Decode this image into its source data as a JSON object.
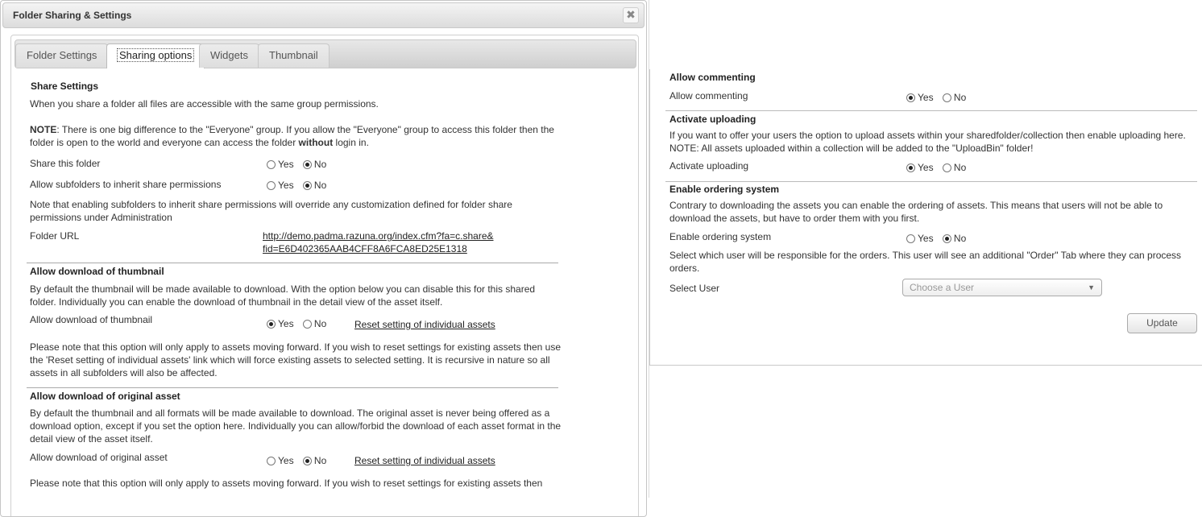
{
  "dialog": {
    "title": "Folder Sharing & Settings",
    "close_glyph": "✖"
  },
  "tabs": [
    {
      "label": "Folder Settings",
      "active": false
    },
    {
      "label": "Sharing options",
      "active": true
    },
    {
      "label": "Widgets",
      "active": false
    },
    {
      "label": "Thumbnail",
      "active": false
    }
  ],
  "share": {
    "heading": "Share Settings",
    "intro": "When you share a folder all files are accessible with the same group permissions.",
    "note_label": "NOTE",
    "note_text_1": ": There is one big difference to the \"Everyone\" group. If you allow the \"Everyone\" group to access this folder then the folder is open to the world and everyone can access the folder ",
    "note_bold": "without",
    "note_text_2": " login in.",
    "share_folder_label": "Share this folder",
    "share_folder_value": "No",
    "inherit_label": "Allow subfolders to inherit share permissions",
    "inherit_value": "No",
    "inherit_note": "Note that enabling subfolders to inherit share permissions will override any customization defined for folder share permissions under Administration",
    "folder_url_label": "Folder URL",
    "folder_url_line1": "http://demo.padma.razuna.org/index.cfm?fa=c.share&",
    "folder_url_line2": "fid=E6D402365AAB4CFF8A6FCA8ED25E1318"
  },
  "radio_labels": {
    "yes": "Yes",
    "no": "No"
  },
  "thumb": {
    "heading": "Allow download of thumbnail",
    "desc": "By default the thumbnail will be made available to download. With the option below you can disable this for this shared folder. Individually you can enable the download of thumbnail in the detail view of the asset itself.",
    "label": "Allow download of thumbnail",
    "value": "Yes",
    "reset_link": "Reset setting of individual assets",
    "note": "Please note that this option will only apply to assets moving forward. If you wish to reset settings for existing assets then use the 'Reset setting of individual assets' link which will force existing assets to selected setting. It is recursive in nature so all assets in all subfolders will also be affected."
  },
  "original": {
    "heading": "Allow download of original asset",
    "desc": "By default the thumbnail and all formats will be made available to download. The original asset is never being offered as a download option, except if you set the option here. Individually you can allow/forbid the download of each asset format in the detail view of the asset itself.",
    "label": "Allow download of original asset",
    "value": "No",
    "reset_link": "Reset setting of individual assets",
    "note": "Please note that this option will only apply to assets moving forward. If you wish to reset settings for existing assets then"
  },
  "commenting": {
    "heading": "Allow commenting",
    "label": "Allow commenting",
    "value": "Yes"
  },
  "uploading": {
    "heading": "Activate uploading",
    "desc": "If you want to offer your users the option to upload assets within your sharedfolder/collection then enable uploading here. NOTE: All assets uploaded within a collection will be added to the \"UploadBin\" folder!",
    "label": "Activate uploading",
    "value": "Yes"
  },
  "ordering": {
    "heading": "Enable ordering system",
    "desc": "Contrary to downloading the assets you can enable the ordering of assets. This means that users will not be able to download the assets, but have to order them with you first.",
    "label": "Enable ordering system",
    "value": "No",
    "user_note": "Select which user will be responsible for the orders. This user will see an additional \"Order\" Tab where they can process orders.",
    "select_label": "Select User",
    "select_placeholder": "Choose a User"
  },
  "update_button": "Update"
}
